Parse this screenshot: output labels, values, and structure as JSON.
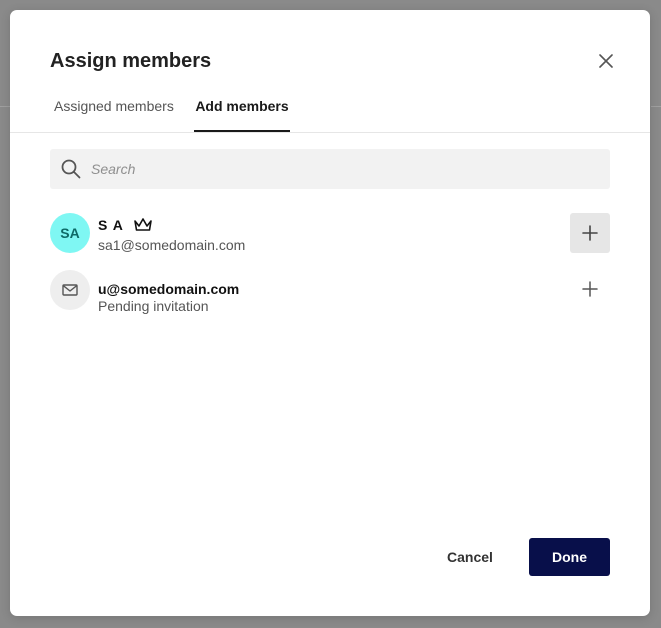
{
  "dialog": {
    "title": "Assign members",
    "close_icon": "close-icon"
  },
  "tabs": [
    {
      "label": "Assigned members",
      "active": false
    },
    {
      "label": "Add members",
      "active": true
    }
  ],
  "search": {
    "placeholder": "Search",
    "value": "",
    "icon": "search-icon"
  },
  "members": [
    {
      "initials": "SA",
      "name": "S A",
      "subtitle": "sa1@somedomain.com",
      "badge_icon": "crown-icon",
      "avatar_color": "#7ff7f3",
      "action_icon": "plus-icon"
    },
    {
      "avatar_icon": "mail-icon",
      "name": "u@somedomain.com",
      "subtitle": "Pending invitation",
      "action_icon": "plus-icon"
    }
  ],
  "footer": {
    "cancel_label": "Cancel",
    "done_label": "Done",
    "done_color": "#080f4a"
  }
}
